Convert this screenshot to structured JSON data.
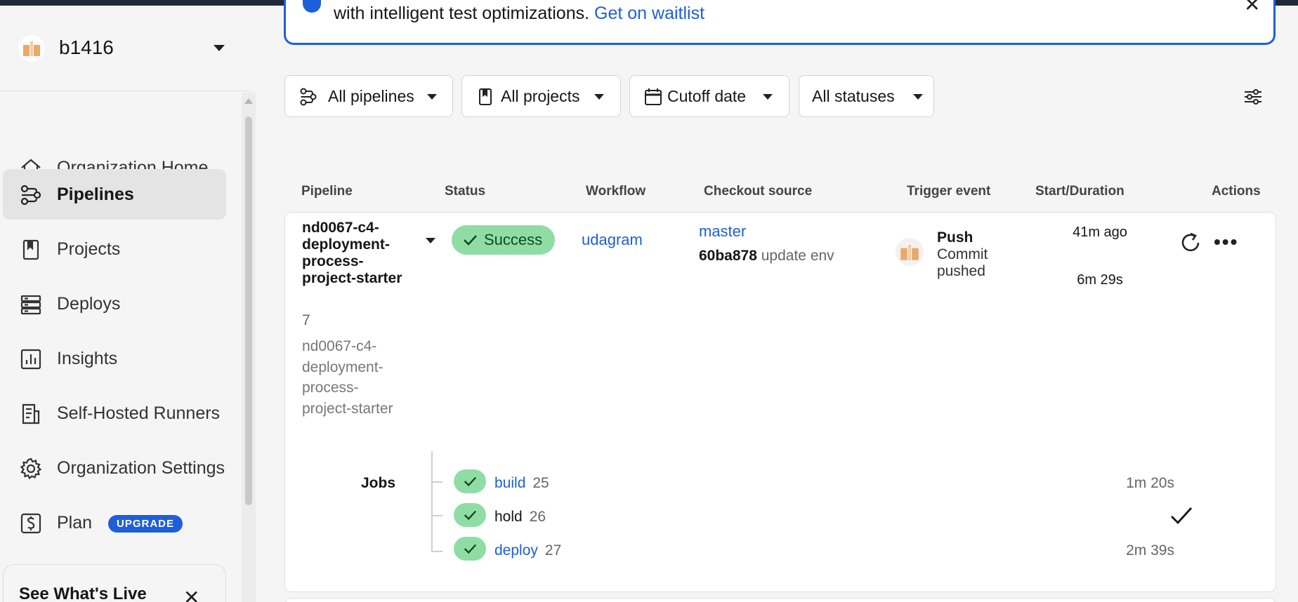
{
  "org": {
    "name": "b1416"
  },
  "sidebar": {
    "items": [
      {
        "label": "Organization Home",
        "icon": "home-icon"
      },
      {
        "label": "Pipelines",
        "icon": "pipelines-icon",
        "active": true
      },
      {
        "label": "Projects",
        "icon": "projects-icon"
      },
      {
        "label": "Deploys",
        "icon": "deploys-icon"
      },
      {
        "label": "Insights",
        "icon": "insights-icon"
      },
      {
        "label": "Self-Hosted Runners",
        "icon": "runners-icon"
      },
      {
        "label": "Organization Settings",
        "icon": "gear-icon"
      },
      {
        "label": "Plan",
        "icon": "dollar-icon",
        "badge": "UPGRADE"
      }
    ],
    "whats_live": {
      "title": "See What's Live",
      "close": "✕"
    }
  },
  "banner": {
    "text": "with intelligent test optimizations.",
    "link": "Get on waitlist",
    "close": "✕"
  },
  "filters": {
    "pipelines": "All pipelines",
    "projects": "All projects",
    "date": "Cutoff date",
    "statuses": "All statuses"
  },
  "table": {
    "headers": [
      "Pipeline",
      "Status",
      "Workflow",
      "Checkout source",
      "Trigger event",
      "Start/Duration",
      "Actions"
    ]
  },
  "pipeline": {
    "name": "nd0067-c4-deployment-process-project-starter",
    "number": "7",
    "project": "nd0067-c4-deployment-process-project-starter",
    "status": "Success",
    "workflow": "udagram",
    "branch": "master",
    "commit_hash": "60ba878",
    "commit_message": "update env",
    "trigger_title": "Push",
    "trigger_subtitle": "Commit pushed",
    "start": "41m ago",
    "duration": "6m 29s",
    "more": "•••"
  },
  "jobs": {
    "label": "Jobs",
    "items": [
      {
        "name": "build",
        "number": "25",
        "duration": "1m 20s",
        "link": true
      },
      {
        "name": "hold",
        "number": "26",
        "duration": "",
        "link": false
      },
      {
        "name": "deploy",
        "number": "27",
        "duration": "2m 39s",
        "link": true
      }
    ]
  },
  "colors": {
    "accent": "#1d5fd9",
    "success": "#8fdda5"
  }
}
